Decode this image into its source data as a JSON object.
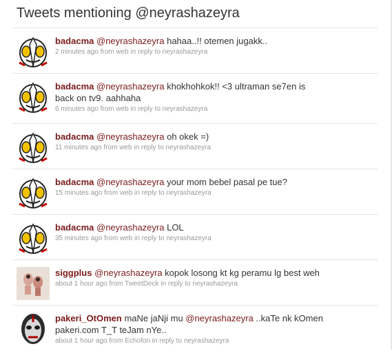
{
  "heading": "Tweets mentioning @neyrashazeyra",
  "tweets": [
    {
      "user": "badacma",
      "text_mention": "@neyrashazeyra",
      "text_rest": "hahaa..!! otemen jugakk..",
      "line2": "",
      "time": "2 minutes ago",
      "from": "from",
      "source": "web",
      "reply": "in reply to",
      "reply_to": "neyrashazeyra",
      "avatar": "ultraman-icon"
    },
    {
      "user": "badacma",
      "text_mention": "@neyrashazeyra",
      "text_rest": "khokhohkok!! <3 ultraman se7en is",
      "line2": "back on tv9. aahhaha",
      "time": "6 minutes ago",
      "from": "from",
      "source": "web",
      "reply": "in reply to",
      "reply_to": "neyrashazeyra",
      "avatar": "ultraman-icon"
    },
    {
      "user": "badacma",
      "text_mention": "@neyrashazeyra",
      "text_rest": "oh okek =)",
      "line2": "",
      "time": "11 minutes ago",
      "from": "from",
      "source": "web",
      "reply": "in reply to",
      "reply_to": "neyrashazeyra",
      "avatar": "ultraman-icon"
    },
    {
      "user": "badacma",
      "text_mention": "@neyrashazeyra",
      "text_rest": "your mom bebel pasal pe tue?",
      "line2": "",
      "time": "15 minutes ago",
      "from": "from",
      "source": "web",
      "reply": "in reply to",
      "reply_to": "neyrashazeyra",
      "avatar": "ultraman-icon"
    },
    {
      "user": "badacma",
      "text_mention": "@neyrashazeyra",
      "text_rest": "LOL",
      "line2": "",
      "time": "35 minutes ago",
      "from": "from",
      "source": "web",
      "reply": "in reply to",
      "reply_to": "neyrashazeyra",
      "avatar": "ultraman-icon"
    },
    {
      "user": "siggplus",
      "text_mention": "@neyrashazeyra",
      "text_rest": "kopok losong kt kg peramu lg best weh",
      "line2": "",
      "time": "about 1 hour ago",
      "from": "from",
      "source": "TweetDeck",
      "reply": "in reply to",
      "reply_to": "neyrashazeyra",
      "avatar": "photo-icon"
    },
    {
      "user": "pakeri_OtOmen",
      "text_pre": "maNe jaNji mu",
      "text_mention": "@neyrashazeyra",
      "text_rest": "..kaTe nk kOmen",
      "line2": "pakeri.com T_T teJam nYe..",
      "time": "about 1 hour ago",
      "from": "from",
      "source": "Echofon",
      "reply": "in reply to",
      "reply_to": "neyrashazeyra",
      "avatar": "robot-mask-icon"
    }
  ],
  "colors": {
    "username": "#7a1a1a",
    "text": "#333333",
    "meta": "#999999",
    "divider": "#e3e3e3"
  }
}
